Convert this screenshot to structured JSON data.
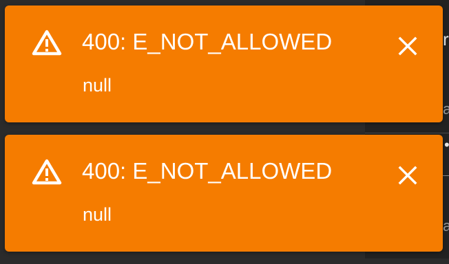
{
  "toasts": [
    {
      "icon": "warning-triangle-icon",
      "title": "400: E_NOT_ALLOWED",
      "message": "null",
      "close_icon": "close-icon"
    },
    {
      "icon": "warning-triangle-icon",
      "title": "400: E_NOT_ALLOWED",
      "message": "null",
      "close_icon": "close-icon"
    }
  ],
  "colors": {
    "toast_background": "#f57c00",
    "toast_text": "#ffffff",
    "app_background": "#2b2b2b"
  }
}
